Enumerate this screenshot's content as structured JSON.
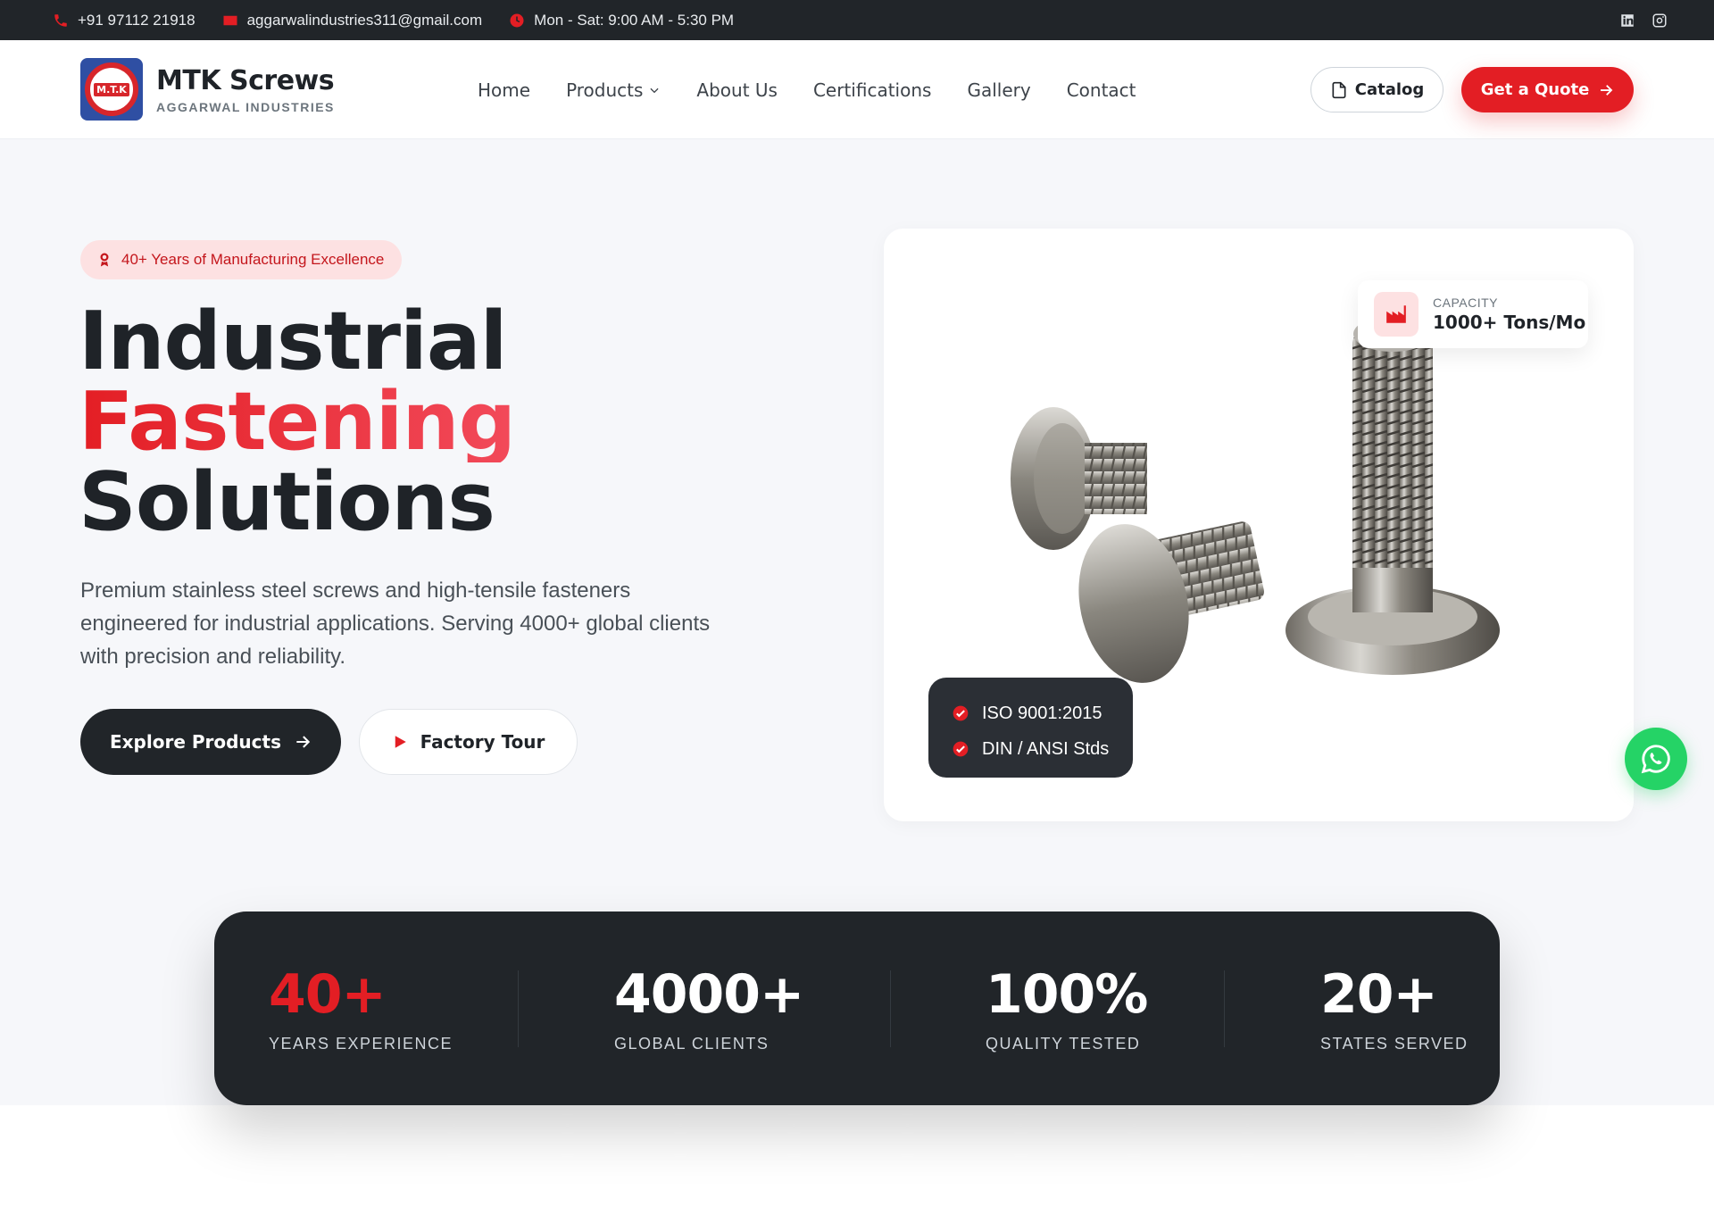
{
  "topbar": {
    "phone": "+91 97112 21918",
    "email": "aggarwalindustries311@gmail.com",
    "hours": "Mon - Sat: 9:00 AM - 5:30 PM",
    "social_icons": [
      "linkedin-icon",
      "instagram-icon"
    ]
  },
  "header": {
    "logo_text": "M.T.K",
    "brand_name": "MTK Screws",
    "brand_sub": "AGGARWAL INDUSTRIES",
    "nav": [
      {
        "label": "Home"
      },
      {
        "label": "Products"
      },
      {
        "label": "About Us"
      },
      {
        "label": "Certifications"
      },
      {
        "label": "Gallery"
      },
      {
        "label": "Contact"
      }
    ],
    "catalog_label": "Catalog",
    "quote_label": "Get a Quote"
  },
  "hero": {
    "badge": "40+ Years of Manufacturing Excellence",
    "headline_1": "Industrial",
    "headline_2": "Fastening",
    "headline_3": "Solutions",
    "lead": "Premium stainless steel screws and high-tensile fasteners engineered for industrial applications. Serving 4000+ global clients with precision and reliability.",
    "explore_label": "Explore Products",
    "tour_label": "Factory Tour",
    "capacity_label": "CAPACITY",
    "capacity_value": "1000+ Tons/Mo",
    "certs": [
      "ISO 9001:2015",
      "DIN / ANSI Stds"
    ]
  },
  "stats": [
    {
      "value": "40+",
      "label": "YEARS EXPERIENCE"
    },
    {
      "value": "4000+",
      "label": "GLOBAL CLIENTS"
    },
    {
      "value": "100%",
      "label": "QUALITY TESTED"
    },
    {
      "value": "20+",
      "label": "STATES SERVED"
    }
  ],
  "colors": {
    "accent": "#e31e24",
    "dark": "#212529",
    "whatsapp": "#25d366"
  }
}
